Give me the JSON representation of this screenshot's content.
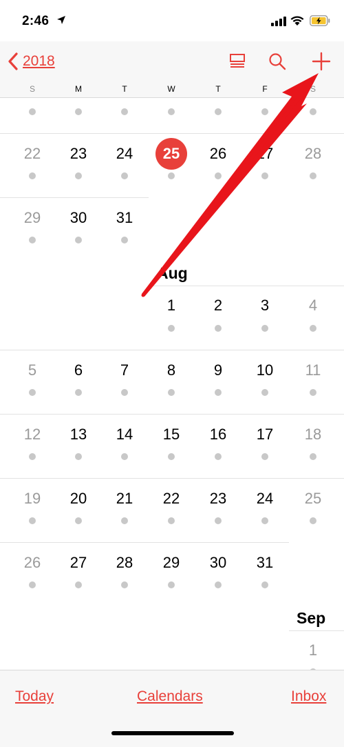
{
  "status_bar": {
    "time": "2:46",
    "icons": [
      "location-arrow-icon",
      "cellular-signal-icon",
      "wifi-icon",
      "battery-charging-icon"
    ]
  },
  "nav": {
    "back_label": "2018",
    "buttons": [
      "list-view-icon",
      "search-icon",
      "add-icon"
    ]
  },
  "weekdays": [
    "S",
    "M",
    "T",
    "W",
    "T",
    "F",
    "S"
  ],
  "months": {
    "aug": "Aug",
    "sep": "Sep"
  },
  "july": {
    "week_top_partial": "dots",
    "week_22": [
      "22",
      "23",
      "24",
      "25",
      "26",
      "27",
      "28"
    ],
    "week_29": [
      "29",
      "30",
      "31"
    ],
    "today": "25"
  },
  "august": {
    "week_1": [
      "1",
      "2",
      "3",
      "4"
    ],
    "week_2": [
      "5",
      "6",
      "7",
      "8",
      "9",
      "10",
      "11"
    ],
    "week_3": [
      "12",
      "13",
      "14",
      "15",
      "16",
      "17",
      "18"
    ],
    "week_4": [
      "19",
      "20",
      "21",
      "22",
      "23",
      "24",
      "25"
    ],
    "week_5": [
      "26",
      "27",
      "28",
      "29",
      "30",
      "31"
    ]
  },
  "september": {
    "week_1": [
      "1"
    ]
  },
  "tabs": {
    "today": "Today",
    "calendars": "Calendars",
    "inbox": "Inbox"
  },
  "colors": {
    "accent": "#e8403a",
    "annotation_arrow": "#e8151b",
    "dot": "#c8c8c8",
    "weekend_text": "#9a9a9a"
  }
}
